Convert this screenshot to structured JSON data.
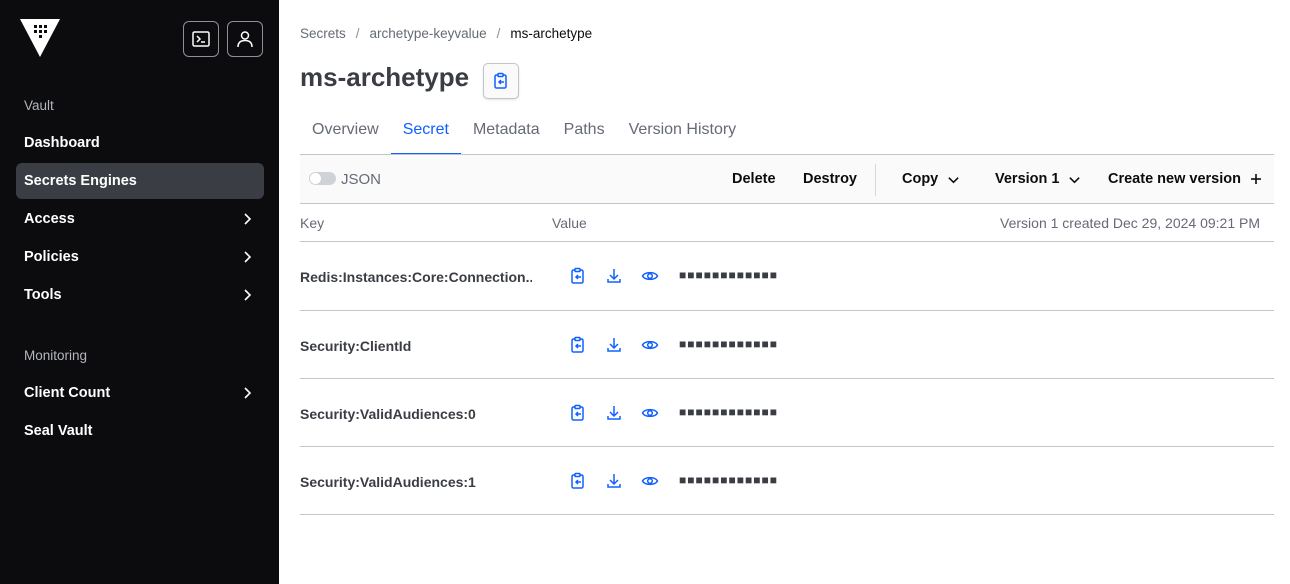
{
  "sidebar": {
    "sections": [
      {
        "heading": "Vault",
        "items": [
          {
            "label": "Dashboard",
            "active": false,
            "has_chevron": false
          },
          {
            "label": "Secrets Engines",
            "active": true,
            "has_chevron": false
          },
          {
            "label": "Access",
            "active": false,
            "has_chevron": true
          },
          {
            "label": "Policies",
            "active": false,
            "has_chevron": true
          },
          {
            "label": "Tools",
            "active": false,
            "has_chevron": true
          }
        ]
      },
      {
        "heading": "Monitoring",
        "items": [
          {
            "label": "Client Count",
            "active": false,
            "has_chevron": true
          },
          {
            "label": "Seal Vault",
            "active": false,
            "has_chevron": false
          }
        ]
      }
    ],
    "icons": {
      "logo": "vault-logo-icon",
      "console": "terminal-icon",
      "user": "user-icon"
    }
  },
  "breadcrumb": [
    "Secrets",
    "archetype-keyvalue",
    "ms-archetype"
  ],
  "breadcrumb_separator": "/",
  "page_title": "ms-archetype",
  "tabs": [
    {
      "label": "Overview",
      "active": false
    },
    {
      "label": "Secret",
      "active": true
    },
    {
      "label": "Metadata",
      "active": false
    },
    {
      "label": "Paths",
      "active": false
    },
    {
      "label": "Version History",
      "active": false
    }
  ],
  "toolbar": {
    "json_toggle_label": "JSON",
    "json_toggle_on": false,
    "delete_label": "Delete",
    "destroy_label": "Destroy",
    "copy_label": "Copy",
    "version_label": "Version 1",
    "create_label": "Create new version"
  },
  "table": {
    "key_header": "Key",
    "value_header": "Value",
    "version_info": "Version 1 created Dec 29, 2024 09:21 PM",
    "masked_value": "■■■■■■■■■■■■",
    "rows": [
      {
        "key": "Redis:Instances:Core:Connection..."
      },
      {
        "key": "Security:ClientId"
      },
      {
        "key": "Security:ValidAudiences:0"
      },
      {
        "key": "Security:ValidAudiences:1"
      }
    ]
  },
  "colors": {
    "accent": "#1060ff",
    "sidebar_bg": "#0c0c0e",
    "active_nav": "#3b3d45"
  }
}
